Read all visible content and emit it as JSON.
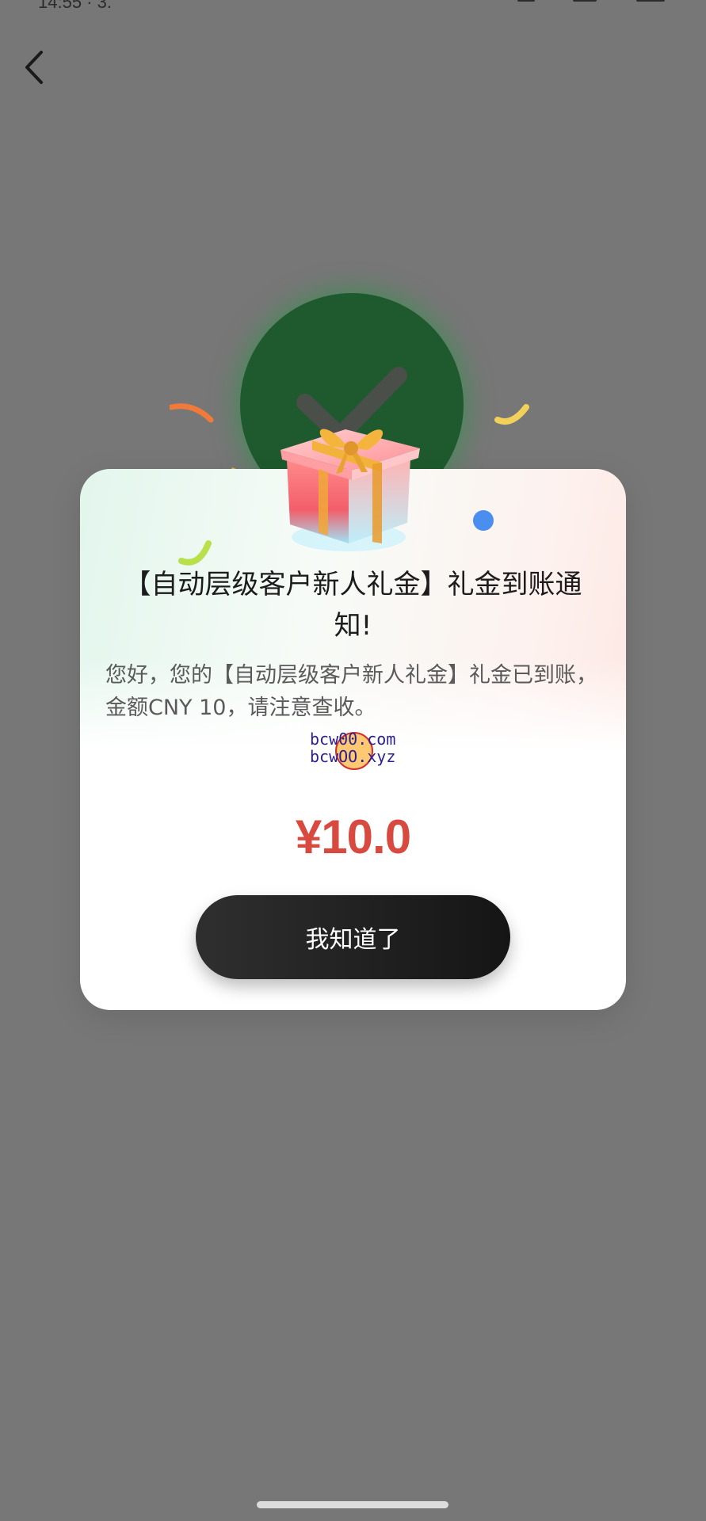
{
  "status_bar": {
    "time": "14:55 · 3."
  },
  "nav": {
    "back_icon": "chevron-left-icon"
  },
  "dialog": {
    "title": "【自动层级客户新人礼金】礼金到账通知!",
    "message": "您好，您的【自动层级客户新人礼金】礼金已到账，金额CNY 10，请注意查收。",
    "watermark_line1": "bcw00.com",
    "watermark_line2": "bcwOO.xyz",
    "amount": "¥10.0",
    "confirm_label": "我知道了"
  },
  "colors": {
    "overlay": "#777777",
    "success_circle": "#1e5a2e",
    "amount": "#d8493f",
    "button": "#1a1a1a"
  },
  "icons": {
    "back": "chevron-left-icon",
    "success": "check-circle-icon",
    "gift": "gift-box-icon"
  }
}
